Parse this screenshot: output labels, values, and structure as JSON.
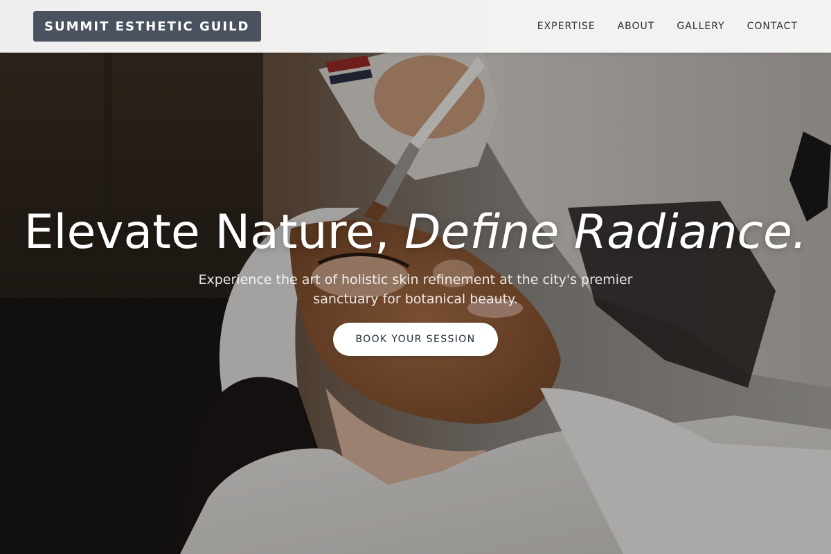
{
  "navbar": {
    "brand": "SUMMIT ESTHETIC GUILD",
    "links": [
      "EXPERTISE",
      "ABOUT",
      "GALLERY",
      "CONTACT"
    ]
  },
  "hero": {
    "title_plain": "Elevate Nature, ",
    "title_accent": "Define Radiance.",
    "subtitle": "Experience the art of holistic skin refinement at the city's premier sanctuary for botanical beauty.",
    "cta_label": "BOOK YOUR SESSION"
  },
  "colors": {
    "brand_bg": "#4a5260",
    "navbar_bg": "#f8f8f8",
    "nav_text": "#2a2f38",
    "cta_bg": "#ffffff",
    "cta_text": "#1f2a38"
  }
}
